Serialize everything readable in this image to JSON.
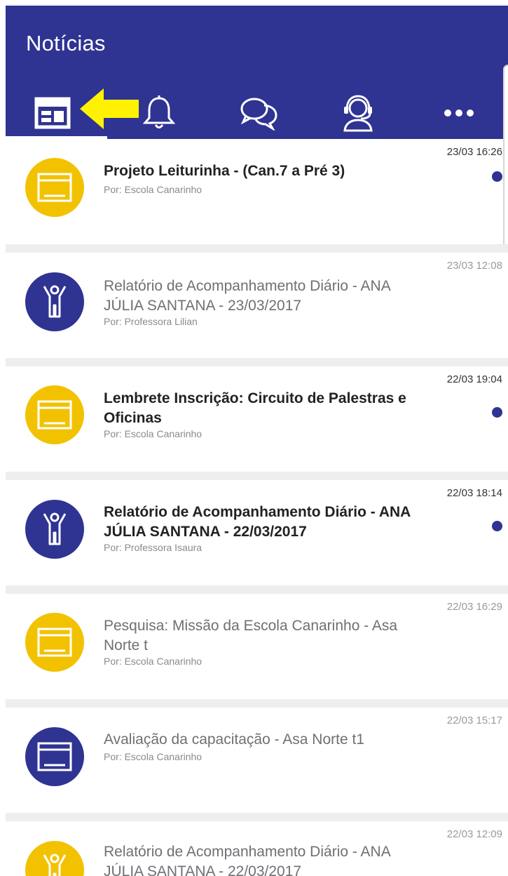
{
  "header": {
    "title": "Notícias",
    "tabs": [
      {
        "icon": "newspaper-icon",
        "active": true
      },
      {
        "icon": "bell-icon",
        "active": false
      },
      {
        "icon": "chat-bubbles-icon",
        "active": false
      },
      {
        "icon": "support-agent-icon",
        "active": false
      },
      {
        "icon": "more-dots-icon",
        "active": false
      }
    ]
  },
  "colors": {
    "brand_blue": "#2f3392",
    "accent_yellow": "#f2c200",
    "annotation_arrow": "#fff200"
  },
  "news": [
    {
      "title": "Projeto Leiturinha - (Can.7 a Pré 3)",
      "author": "Por: Escola Canarinho",
      "time": "23/03 16:26",
      "unread": true,
      "icon": "news-card-icon",
      "avatar_color": "yellow"
    },
    {
      "title": "Relatório de Acompanhamento Diário - ANA  JÚLIA SANTANA - 23/03/2017",
      "author": "Por: Professora Lilian",
      "time": "23/03 12:08",
      "unread": false,
      "icon": "child-figure-icon",
      "avatar_color": "blue"
    },
    {
      "title": "Lembrete Inscrição: Circuito de Palestras e Oficinas",
      "author": "Por: Escola Canarinho",
      "time": "22/03 19:04",
      "unread": true,
      "icon": "news-card-icon",
      "avatar_color": "yellow"
    },
    {
      "title": "Relatório de Acompanhamento Diário - ANA  JÚLIA SANTANA - 22/03/2017",
      "author": "Por: Professora Isaura",
      "time": "22/03 18:14",
      "unread": true,
      "icon": "child-figure-icon",
      "avatar_color": "blue"
    },
    {
      "title": "Pesquisa: Missão da Escola Canarinho - Asa Norte t",
      "author": "Por: Escola Canarinho",
      "time": "22/03 16:29",
      "unread": false,
      "icon": "news-card-icon",
      "avatar_color": "yellow"
    },
    {
      "title": "Avaliação da capacitação - Asa Norte t1",
      "author": "Por: Escola Canarinho",
      "time": "22/03 15:17",
      "unread": false,
      "icon": "news-card-icon",
      "avatar_color": "blue"
    },
    {
      "title": "Relatório de Acompanhamento Diário - ANA  JÚLIA SANTANA - 22/03/2017",
      "author": "",
      "time": "22/03 12:09",
      "unread": false,
      "icon": "child-figure-icon",
      "avatar_color": "yellow"
    }
  ]
}
